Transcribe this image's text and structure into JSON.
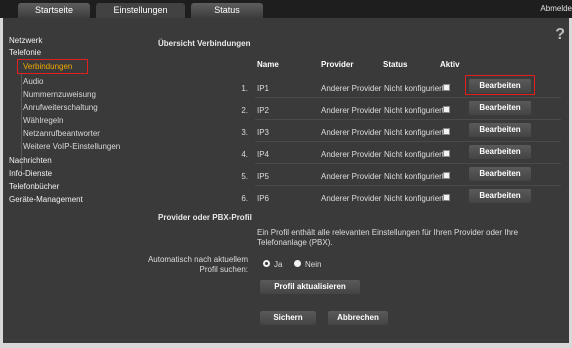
{
  "tabs": [
    {
      "label": "Startseite"
    },
    {
      "label": "Einstellungen"
    },
    {
      "label": "Status"
    }
  ],
  "logout": "Abmelde",
  "sidebar": {
    "items": [
      {
        "label": "Netzwerk"
      },
      {
        "label": "Telefonie"
      },
      {
        "label": "Verbindungen"
      },
      {
        "label": "Audio"
      },
      {
        "label": "Nummernzuweisung"
      },
      {
        "label": "Anrufweiterschaltung"
      },
      {
        "label": "Wählregeln"
      },
      {
        "label": "Netzanrufbeantworter"
      },
      {
        "label": "Weitere VoIP-Einstellungen"
      },
      {
        "label": "Nachrichten"
      },
      {
        "label": "Info-Dienste"
      },
      {
        "label": "Telefonbücher"
      },
      {
        "label": "Geräte-Management"
      }
    ]
  },
  "help": "?",
  "overview": {
    "title": "Übersicht Verbindungen",
    "columns": {
      "name": "Name",
      "provider": "Provider",
      "status": "Status",
      "active": "Aktiv"
    },
    "rows": [
      {
        "num": "1.",
        "name": "IP1",
        "provider": "Anderer Provider",
        "status": "Nicht konfiguriert",
        "button": "Bearbeiten"
      },
      {
        "num": "2.",
        "name": "IP2",
        "provider": "Anderer Provider",
        "status": "Nicht konfiguriert",
        "button": "Bearbeiten"
      },
      {
        "num": "3.",
        "name": "IP3",
        "provider": "Anderer Provider",
        "status": "Nicht konfiguriert",
        "button": "Bearbeiten"
      },
      {
        "num": "4.",
        "name": "IP4",
        "provider": "Anderer Provider",
        "status": "Nicht konfiguriert",
        "button": "Bearbeiten"
      },
      {
        "num": "5.",
        "name": "IP5",
        "provider": "Anderer Provider",
        "status": "Nicht konfiguriert",
        "button": "Bearbeiten"
      },
      {
        "num": "6.",
        "name": "IP6",
        "provider": "Anderer Provider",
        "status": "Nicht konfiguriert",
        "button": "Bearbeiten"
      }
    ]
  },
  "profile": {
    "title": "Provider oder PBX-Profil",
    "info": "Ein Profil enthält alle relevanten Einstellungen für Ihren Provider oder Ihre Telefonanlage (PBX).",
    "auto_label": "Automatisch nach aktuellem Profil suchen:",
    "yes": "Ja",
    "no": "Nein",
    "update_button": "Profil aktualisieren"
  },
  "footer": {
    "save": "Sichern",
    "cancel": "Abbrechen"
  }
}
